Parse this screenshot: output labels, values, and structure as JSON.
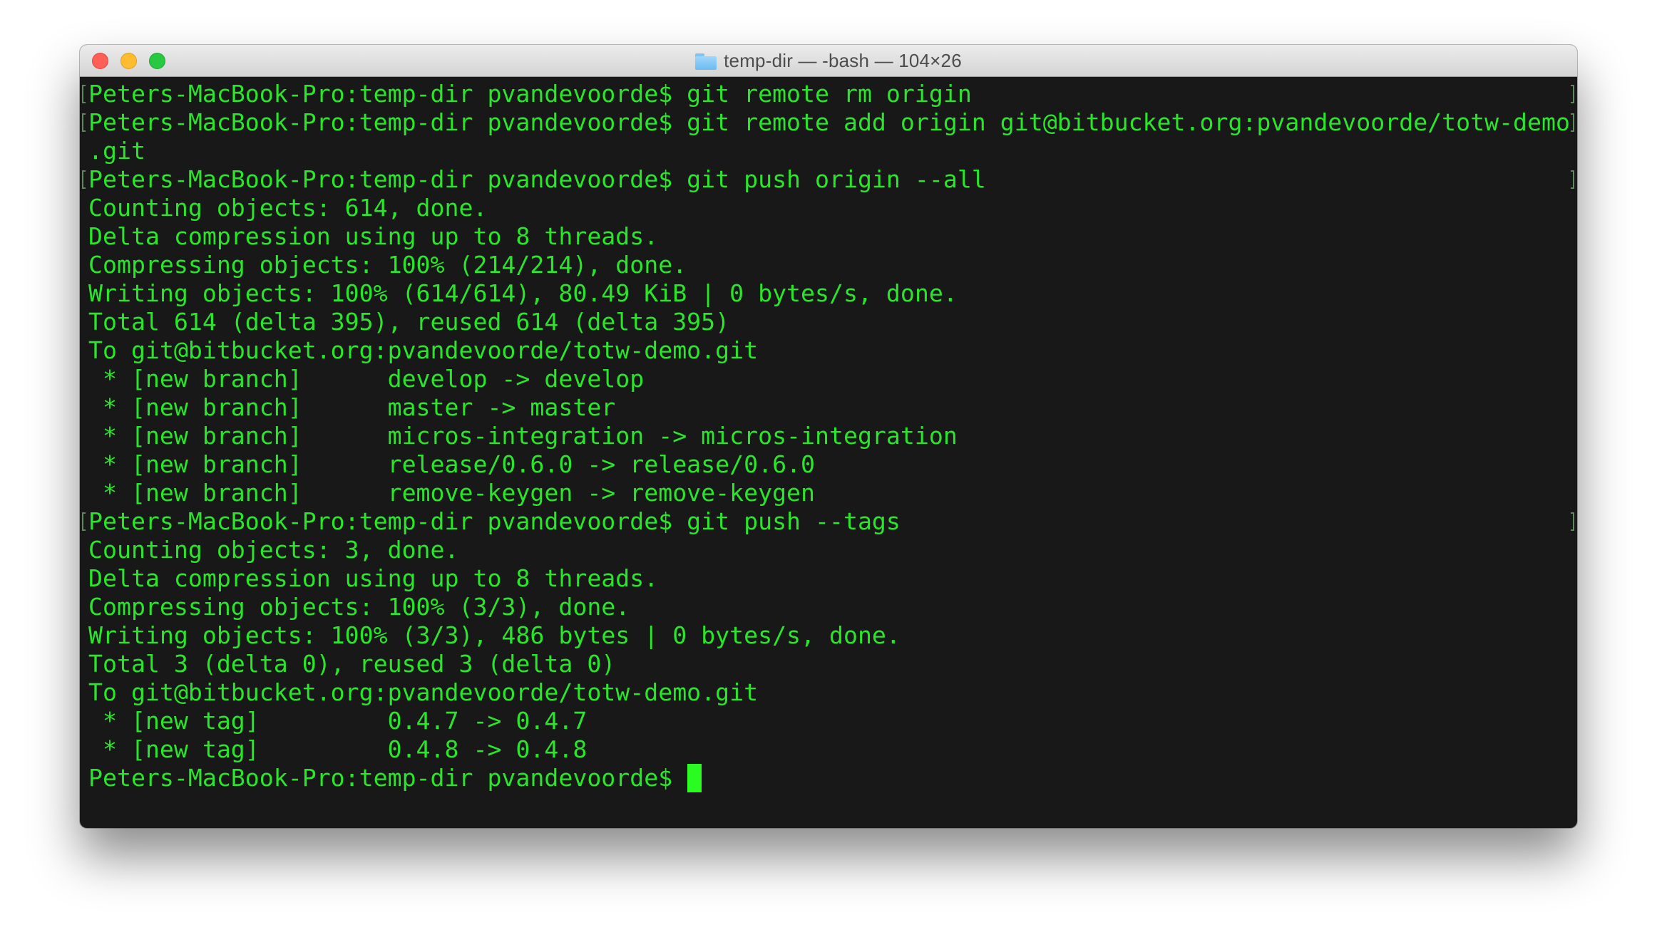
{
  "window": {
    "title": "temp-dir — -bash — 104×26",
    "title_icon": "folder-icon",
    "controls": [
      "close",
      "minimize",
      "zoom"
    ]
  },
  "terminal": {
    "colors": {
      "background": "#181818",
      "foreground": "#2ae62a",
      "cursor": "#2afc22",
      "mark": "#5c8a5c"
    },
    "prompt": "Peters-MacBook-Pro:temp-dir pvandevoorde$ ",
    "lines": [
      {
        "text": "Peters-MacBook-Pro:temp-dir pvandevoorde$ git remote rm origin",
        "marked": true
      },
      {
        "text": "Peters-MacBook-Pro:temp-dir pvandevoorde$ git remote add origin git@bitbucket.org:pvandevoorde/totw-demo",
        "marked": true
      },
      {
        "text": ".git",
        "marked": false
      },
      {
        "text": "Peters-MacBook-Pro:temp-dir pvandevoorde$ git push origin --all",
        "marked": true
      },
      {
        "text": "Counting objects: 614, done.",
        "marked": false
      },
      {
        "text": "Delta compression using up to 8 threads.",
        "marked": false
      },
      {
        "text": "Compressing objects: 100% (214/214), done.",
        "marked": false
      },
      {
        "text": "Writing objects: 100% (614/614), 80.49 KiB | 0 bytes/s, done.",
        "marked": false
      },
      {
        "text": "Total 614 (delta 395), reused 614 (delta 395)",
        "marked": false
      },
      {
        "text": "To git@bitbucket.org:pvandevoorde/totw-demo.git",
        "marked": false
      },
      {
        "text": " * [new branch]      develop -> develop",
        "marked": false
      },
      {
        "text": " * [new branch]      master -> master",
        "marked": false
      },
      {
        "text": " * [new branch]      micros-integration -> micros-integration",
        "marked": false
      },
      {
        "text": " * [new branch]      release/0.6.0 -> release/0.6.0",
        "marked": false
      },
      {
        "text": " * [new branch]      remove-keygen -> remove-keygen",
        "marked": false
      },
      {
        "text": "Peters-MacBook-Pro:temp-dir pvandevoorde$ git push --tags",
        "marked": true
      },
      {
        "text": "Counting objects: 3, done.",
        "marked": false
      },
      {
        "text": "Delta compression using up to 8 threads.",
        "marked": false
      },
      {
        "text": "Compressing objects: 100% (3/3), done.",
        "marked": false
      },
      {
        "text": "Writing objects: 100% (3/3), 486 bytes | 0 bytes/s, done.",
        "marked": false
      },
      {
        "text": "Total 3 (delta 0), reused 3 (delta 0)",
        "marked": false
      },
      {
        "text": "To git@bitbucket.org:pvandevoorde/totw-demo.git",
        "marked": false
      },
      {
        "text": " * [new tag]         0.4.7 -> 0.4.7",
        "marked": false
      },
      {
        "text": " * [new tag]         0.4.8 -> 0.4.8",
        "marked": false
      },
      {
        "text": "Peters-MacBook-Pro:temp-dir pvandevoorde$ ",
        "marked": false,
        "cursor": true
      }
    ]
  }
}
